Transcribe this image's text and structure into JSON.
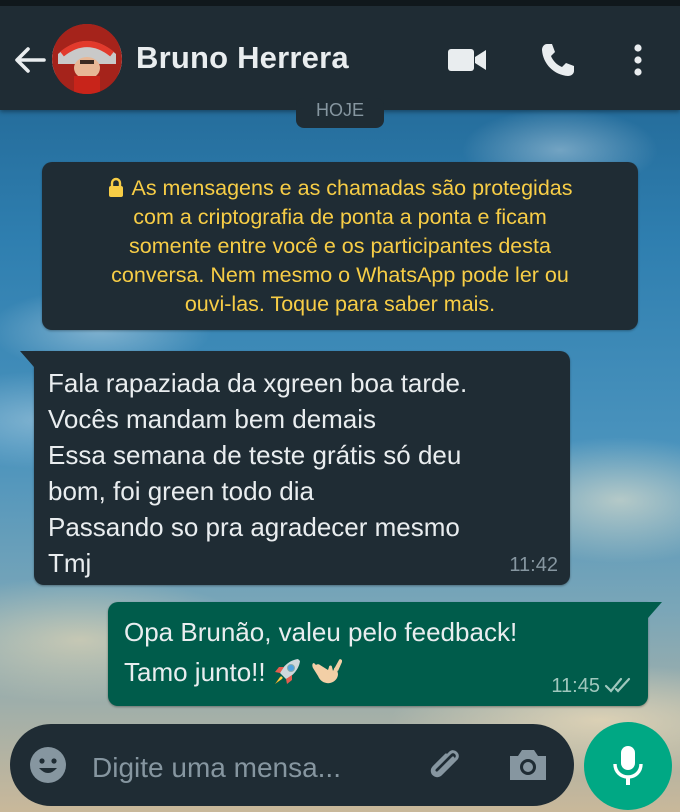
{
  "header": {
    "contact_name": "Bruno Herrera",
    "back_icon": "arrow-left-icon",
    "avatar_icon": "contact-avatar",
    "actions": [
      "video-call-icon",
      "voice-call-icon",
      "more-vert-icon"
    ]
  },
  "date_chip": "HOJE",
  "encryption_notice": {
    "icon": "lock-icon",
    "lines": [
      "As mensagens e as chamadas são protegidas",
      "com a criptografia de ponta a ponta e ficam",
      "somente entre você e os participantes desta",
      "conversa. Nem mesmo o WhatsApp pode ler ou",
      "ouvi-las. Toque para saber mais."
    ]
  },
  "messages": [
    {
      "direction": "incoming",
      "lines": [
        "Fala rapaziada da xgreen boa tarde.",
        "Vocês mandam bem demais",
        "Essa semana de teste grátis só deu",
        "bom, foi green todo dia",
        "Passando so pra agradecer mesmo",
        "Tmj"
      ],
      "time": "11:42"
    },
    {
      "direction": "outgoing",
      "lines": [
        "Opa Brunão, valeu pelo feedback!",
        "Tamo junto!!"
      ],
      "emojis": [
        "rocket-emoji",
        "call-me-hand-emoji"
      ],
      "time": "11:45",
      "status": "read-double-check-icon"
    }
  ],
  "composer": {
    "placeholder": "Digite uma mensa...",
    "icons": [
      "emoji-icon",
      "attach-icon",
      "camera-icon",
      "mic-icon"
    ]
  },
  "colors": {
    "header_bg": "#1f2c34",
    "incoming_bubble": "#1f2c34",
    "outgoing_bubble": "#005c4b",
    "encryption_text": "#f7cd46",
    "accent": "#00a884"
  }
}
